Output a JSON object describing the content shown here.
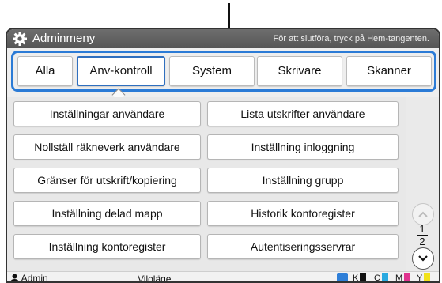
{
  "titlebar": {
    "title": "Adminmeny",
    "hint": "För att slutföra, tryck på Hem-tangenten."
  },
  "tabs": [
    {
      "label": "Alla",
      "active": false
    },
    {
      "label": "Anv-kontroll",
      "active": true
    },
    {
      "label": "System",
      "active": false
    },
    {
      "label": "Skrivare",
      "active": false
    },
    {
      "label": "Skanner",
      "active": false
    }
  ],
  "menu": {
    "left": [
      "Inställningar användare",
      "Nollställ räkneverk användare",
      "Gränser för utskrift/kopiering",
      "Inställning delad mapp",
      "Inställning kontoregister"
    ],
    "right": [
      "Lista utskrifter användare",
      "Inställning inloggning",
      "Inställning grupp",
      "Historik kontoregister",
      "Autentiseringsservrar"
    ]
  },
  "pager": {
    "current": "1",
    "total": "2"
  },
  "status": {
    "user": "Admin",
    "mode": "Viloläge",
    "inks": [
      {
        "label": "K",
        "color": "#111111"
      },
      {
        "label": "C",
        "color": "#29a9e0"
      },
      {
        "label": "M",
        "color": "#e0338f"
      },
      {
        "label": "Y",
        "color": "#f2e21b"
      }
    ]
  },
  "colors": {
    "accent": "#2b7bd6",
    "titlebar": "#5f5f5f"
  }
}
